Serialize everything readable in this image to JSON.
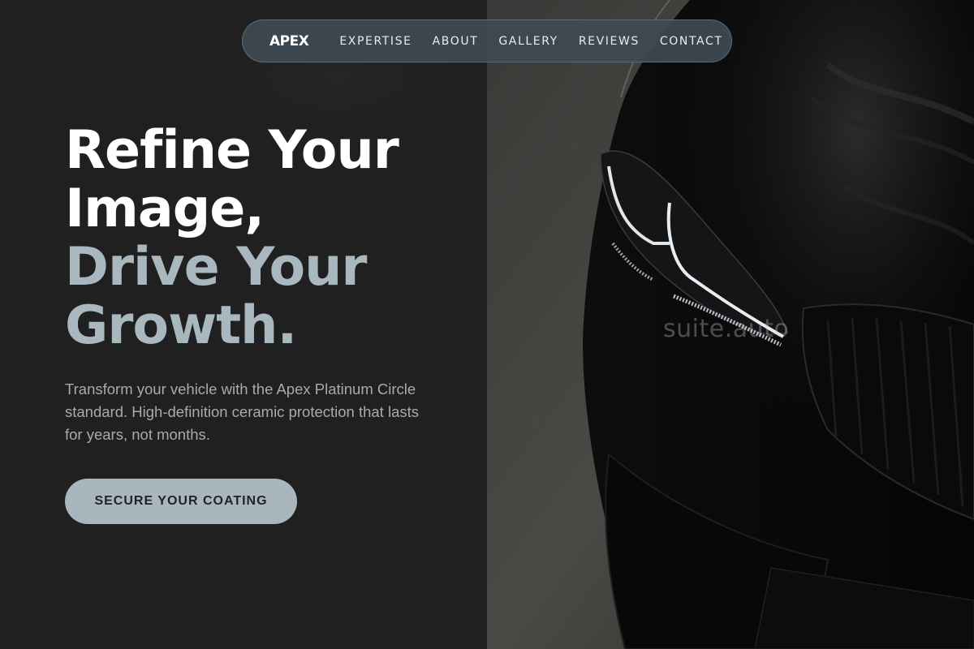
{
  "nav": {
    "brand": "APEX",
    "links": [
      "EXPERTISE",
      "ABOUT",
      "GALLERY",
      "REVIEWS",
      "CONTACT"
    ]
  },
  "hero": {
    "headline_line1": "Refine Your",
    "headline_line2": "Image,",
    "headline_line3": "Drive Your",
    "headline_line4": "Growth.",
    "description": "Transform your vehicle with the Apex Platinum Circle standard. High-definition ceramic protection that lasts for years, not months.",
    "cta_label": "SECURE YOUR COATING",
    "image_watermark": "suite.auto"
  },
  "colors": {
    "background": "#202021",
    "accent": "#a9b7bf",
    "nav_bg": "#3e4a52",
    "cta_bg": "#aab6bd"
  }
}
